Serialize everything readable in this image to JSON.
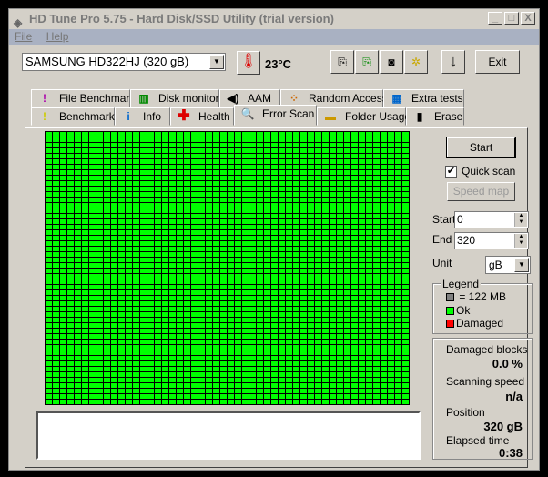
{
  "window": {
    "title": "HD Tune Pro 5.75 - Hard Disk/SSD Utility (trial version)",
    "minimize": "_",
    "maximize": "□",
    "close": "X"
  },
  "menu": {
    "file": "File",
    "help": "Help"
  },
  "toolbar": {
    "drive": "SAMSUNG HD322HJ (320 gB)",
    "temperature": "23°C",
    "exit": "Exit"
  },
  "tabs": {
    "row1": [
      "File Benchmark",
      "Disk monitor",
      "AAM",
      "Random Access",
      "Extra tests"
    ],
    "row2": [
      "Benchmark",
      "Info",
      "Health",
      "Error Scan",
      "Folder Usage",
      "Erase"
    ],
    "active": "Error Scan"
  },
  "controls": {
    "start_button": "Start",
    "quick_scan": "Quick scan",
    "quick_scan_checked": true,
    "speed_map": "Speed map",
    "start_label": "Start",
    "start_value": "0",
    "end_label": "End",
    "end_value": "320",
    "unit_label": "Unit",
    "unit_value": "gB"
  },
  "legend": {
    "title": "Legend",
    "block": "= 122 MB",
    "ok": "Ok",
    "damaged": "Damaged",
    "colors": {
      "block": "#808080",
      "ok": "#00ff00",
      "damaged": "#ff0000"
    }
  },
  "stats": {
    "damaged_blocks_label": "Damaged blocks",
    "damaged_blocks": "0.0 %",
    "scanning_speed_label": "Scanning speed",
    "scanning_speed": "n/a",
    "position_label": "Position",
    "position": "320 gB",
    "elapsed_label": "Elapsed time",
    "elapsed": "0:38"
  }
}
